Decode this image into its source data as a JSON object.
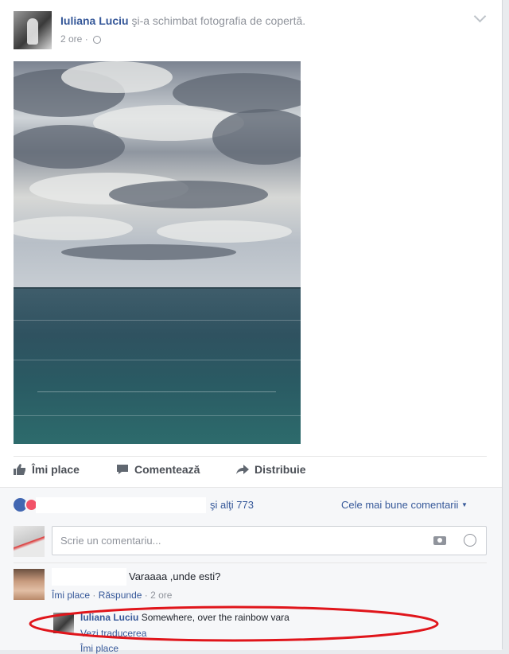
{
  "post": {
    "author_name": "Iuliana Luciu",
    "action_text": "şi-a schimbat fotografia de copertă.",
    "time": "2 ore",
    "separator": "·"
  },
  "actions": {
    "like": "Îmi place",
    "comment": "Comentează",
    "share": "Distribuie"
  },
  "reactions": {
    "others_text": "şi alţi 773",
    "sort_label": "Cele mai bune comentarii"
  },
  "composer": {
    "placeholder": "Scrie un comentariu..."
  },
  "comments": [
    {
      "text": "Varaaaa ,unde esti?",
      "like_label": "Îmi place",
      "reply_label": "Răspunde",
      "time": "2 ore"
    }
  ],
  "reply": {
    "author_name": "Iuliana Luciu",
    "text": "Somewhere, over the rainbow vara",
    "translate_label": "Vezi traducerea",
    "more_label": "Îmi place"
  },
  "colors": {
    "link": "#365899",
    "highlight_circle": "#e0151b",
    "like_reaction": "#4267b2",
    "love_reaction": "#f25268"
  }
}
